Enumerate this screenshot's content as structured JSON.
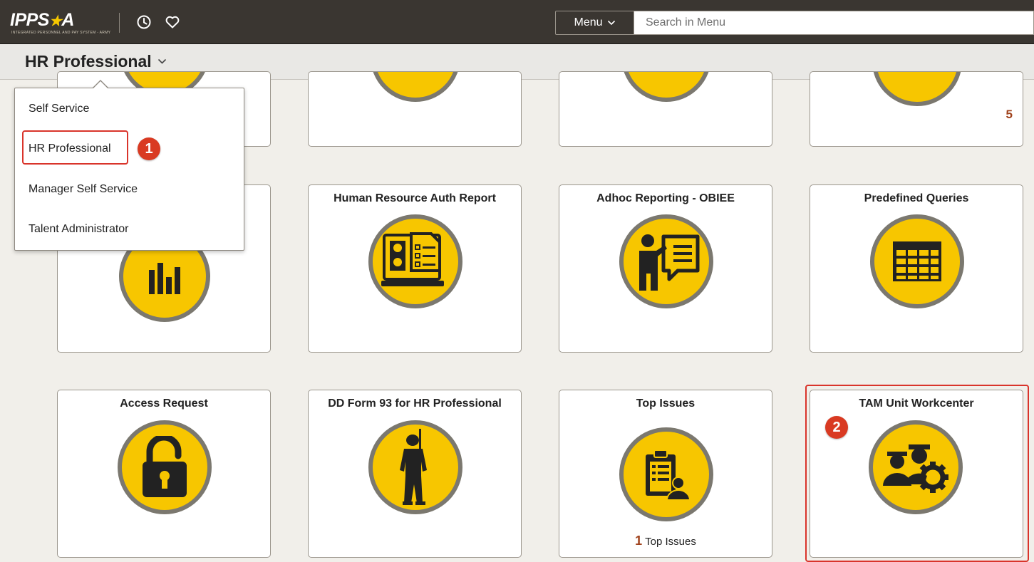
{
  "app": {
    "logo_text": "IPPS",
    "logo_star": "★",
    "logo_a": "A",
    "logo_subtitle": "INTEGRATED PERSONNEL AND PAY SYSTEM - ARMY"
  },
  "header": {
    "menu_label": "Menu",
    "search_placeholder": "Search in Menu",
    "icons": [
      "history-icon",
      "favorites-icon"
    ]
  },
  "homepage_selector": {
    "title": "HR Professional"
  },
  "dropdown": {
    "items": [
      {
        "label": "Self Service"
      },
      {
        "label": "HR Professional"
      },
      {
        "label": "Manager Self Service"
      },
      {
        "label": "Talent Administrator"
      }
    ]
  },
  "tiles": {
    "top_row": {
      "tile_4_count": "5"
    },
    "mid_row": [
      {
        "title": "",
        "icon": "bar-chart-icon"
      },
      {
        "title": "Human Resource Auth Report",
        "icon": "report-checklist-icon"
      },
      {
        "title": "Adhoc Reporting - OBIEE",
        "icon": "presenter-icon"
      },
      {
        "title": "Predefined Queries",
        "icon": "table-grid-icon"
      }
    ],
    "bottom_row": [
      {
        "title": "Access Request",
        "icon": "unlocked-padlock-icon"
      },
      {
        "title": "DD Form 93 for HR Professional",
        "icon": "soldier-silhouette-icon"
      },
      {
        "title": "Top Issues",
        "icon": "clipboard-person-icon",
        "footer_count": "1",
        "footer_label": "Top Issues"
      },
      {
        "title": "TAM Unit Workcenter",
        "icon": "team-gear-icon"
      }
    ]
  },
  "callouts": [
    {
      "label": "1"
    },
    {
      "label": "2"
    }
  ],
  "colors": {
    "topbar": "#3a3631",
    "tile_icon_fill": "#f7c600",
    "tile_icon_ring": "#7b786f",
    "callout_red": "#d93a22",
    "count_color": "#a0421c"
  }
}
